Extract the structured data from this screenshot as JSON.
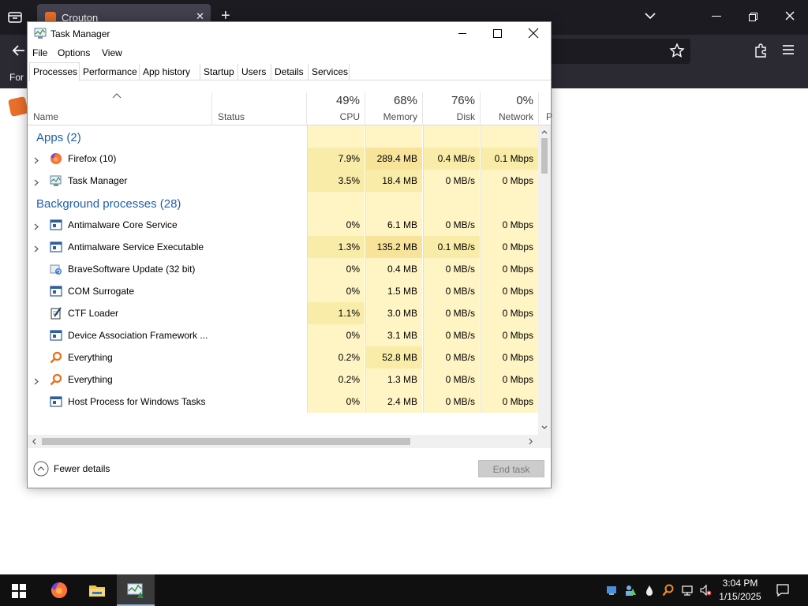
{
  "browser": {
    "tab_title": "Crouton",
    "bookmarks_text": "For"
  },
  "taskmanager": {
    "title": "Task Manager",
    "menu": [
      "File",
      "Options",
      "View"
    ],
    "tabs": [
      "Processes",
      "Performance",
      "App history",
      "Startup",
      "Users",
      "Details",
      "Services"
    ],
    "active_tab": "Processes",
    "header": {
      "name": "Name",
      "status": "Status",
      "cpu_pct": "49%",
      "cpu": "CPU",
      "memory_pct": "68%",
      "memory": "Memory",
      "disk_pct": "76%",
      "disk": "Disk",
      "network_pct": "0%",
      "network": "Network",
      "next_col": "P"
    },
    "groups": [
      {
        "title": "Apps (2)",
        "rows": [
          {
            "name": "Firefox (10)",
            "icon": "firefox-icon",
            "expandable": true,
            "cpu": "7.9%",
            "memory": "289.4 MB",
            "disk": "0.4 MB/s",
            "network": "0.1 Mbps"
          },
          {
            "name": "Task Manager",
            "icon": "task-manager-icon",
            "expandable": true,
            "cpu": "3.5%",
            "memory": "18.4 MB",
            "disk": "0 MB/s",
            "network": "0 Mbps"
          }
        ]
      },
      {
        "title": "Background processes (28)",
        "rows": [
          {
            "name": "Antimalware Core Service",
            "icon": "service-window-icon",
            "expandable": true,
            "cpu": "0%",
            "memory": "6.1 MB",
            "disk": "0 MB/s",
            "network": "0 Mbps"
          },
          {
            "name": "Antimalware Service Executable",
            "icon": "service-window-icon",
            "expandable": true,
            "cpu": "1.3%",
            "memory": "135.2 MB",
            "disk": "0.1 MB/s",
            "network": "0 Mbps"
          },
          {
            "name": "BraveSoftware Update (32 bit)",
            "icon": "update-icon",
            "expandable": false,
            "cpu": "0%",
            "memory": "0.4 MB",
            "disk": "0 MB/s",
            "network": "0 Mbps"
          },
          {
            "name": "COM Surrogate",
            "icon": "service-window-icon",
            "expandable": false,
            "cpu": "0%",
            "memory": "1.5 MB",
            "disk": "0 MB/s",
            "network": "0 Mbps"
          },
          {
            "name": "CTF Loader",
            "icon": "ctf-loader-icon",
            "expandable": false,
            "cpu": "1.1%",
            "memory": "3.0 MB",
            "disk": "0 MB/s",
            "network": "0 Mbps"
          },
          {
            "name": "Device Association Framework ...",
            "icon": "service-window-icon",
            "expandable": false,
            "cpu": "0%",
            "memory": "3.1 MB",
            "disk": "0 MB/s",
            "network": "0 Mbps"
          },
          {
            "name": "Everything",
            "icon": "everything-search-icon",
            "expandable": false,
            "cpu": "0.2%",
            "memory": "52.8 MB",
            "disk": "0 MB/s",
            "network": "0 Mbps"
          },
          {
            "name": "Everything",
            "icon": "everything-search-icon",
            "expandable": true,
            "cpu": "0.2%",
            "memory": "1.3 MB",
            "disk": "0 MB/s",
            "network": "0 Mbps"
          },
          {
            "name": "Host Process for Windows Tasks",
            "icon": "service-window-icon",
            "expandable": false,
            "cpu": "0%",
            "memory": "2.4 MB",
            "disk": "0 MB/s",
            "network": "0 Mbps"
          }
        ]
      }
    ],
    "footer": {
      "fewer_details": "Fewer details",
      "end_task": "End task"
    },
    "colors": {
      "cell_light": "#fff4c4",
      "cell_mid": "#f9eca8",
      "cell_strong": "#f7e49a",
      "group_title": "#1f5fae"
    }
  },
  "taskbar": {
    "time": "3:04 PM",
    "date": "1/15/2025",
    "apps": [
      "firefox-icon",
      "file-explorer-icon",
      "task-manager-icon"
    ]
  }
}
